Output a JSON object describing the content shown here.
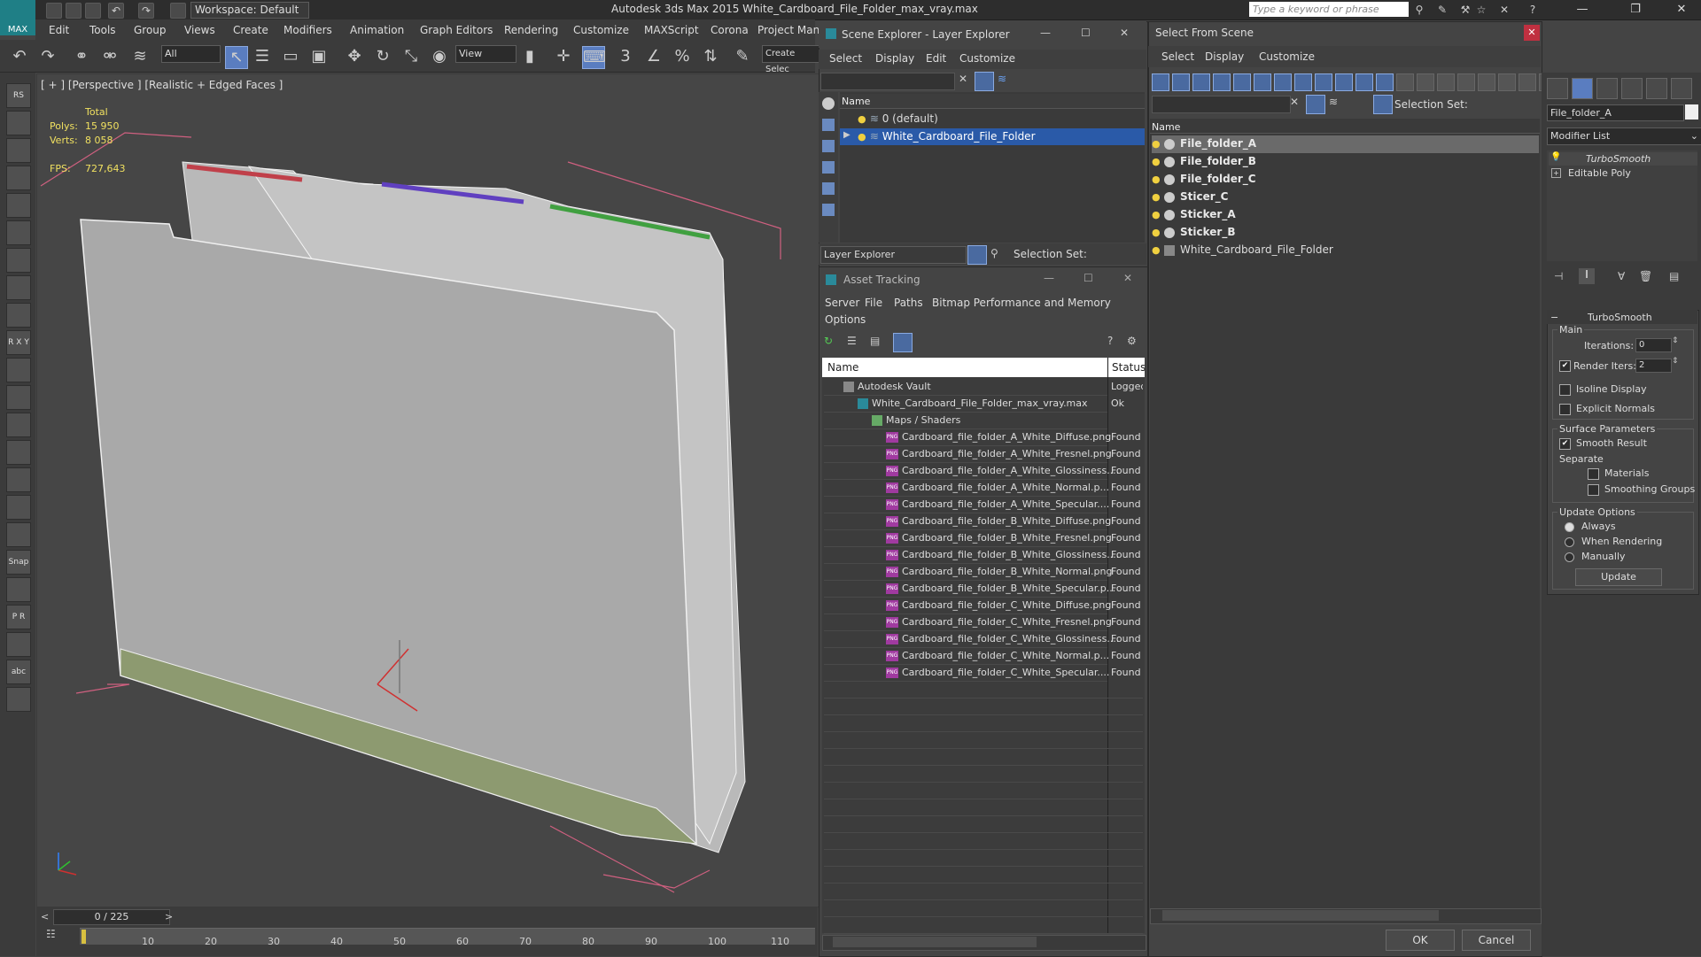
{
  "titlebar": {
    "workspace": "Workspace: Default",
    "app_title": "Autodesk 3ds Max  2015     White_Cardboard_File_Folder_max_vray.max",
    "search_placeholder": "Type a keyword or phrase"
  },
  "menubar": [
    "Edit",
    "Tools",
    "Group",
    "Views",
    "Create",
    "Modifiers",
    "Animation",
    "Graph Editors",
    "Rendering",
    "Customize",
    "MAXScript",
    "Corona",
    "Project Man"
  ],
  "toolbar": {
    "filter_value": "All",
    "coord_value": "View",
    "create_selection": "Create Selec"
  },
  "viewport": {
    "label": "[ + ] [Perspective ] [Realistic + Edged Faces ]",
    "stats_total": "Total",
    "polys_label": "Polys:",
    "polys_value": "15 950",
    "verts_label": "Verts:",
    "verts_value": "8 058",
    "fps_label": "FPS:",
    "fps_value": "727,643"
  },
  "timeline": {
    "frames": "0 / 225",
    "ticks": [
      "10",
      "20",
      "30",
      "40",
      "50",
      "60",
      "70",
      "80",
      "90",
      "100",
      "110"
    ]
  },
  "left_buttons": [
    "RS",
    "",
    "",
    "",
    "",
    "",
    "",
    "",
    "",
    "R X Y Z",
    "",
    "",
    "",
    "",
    "",
    "",
    "",
    "Snap Shot",
    "",
    "P R",
    "",
    "abc",
    ""
  ],
  "scene_explorer": {
    "title": "Scene Explorer - Layer Explorer",
    "menu": [
      "Select",
      "Display",
      "Edit",
      "Customize"
    ],
    "col_name": "Name",
    "rows": [
      "0 (default)",
      "White_Cardboard_File_Folder"
    ],
    "footer_dropdown": "Layer Explorer",
    "selection_set": "Selection Set:"
  },
  "asset_tracking": {
    "title": "Asset Tracking",
    "menu": [
      "Server",
      "File",
      "Paths",
      "Bitmap Performance and Memory"
    ],
    "menu2": "Options",
    "col_name": "Name",
    "col_status": "Status",
    "rows": [
      {
        "name": "Autodesk Vault",
        "status": "Logged",
        "indent": 0,
        "icon": "vault"
      },
      {
        "name": "White_Cardboard_File_Folder_max_vray.max",
        "status": "Ok",
        "indent": 1,
        "icon": "max"
      },
      {
        "name": "Maps / Shaders",
        "status": "",
        "indent": 2,
        "icon": "maps"
      },
      {
        "name": "Cardboard_file_folder_A_White_Diffuse.png",
        "status": "Found",
        "indent": 3,
        "icon": "png"
      },
      {
        "name": "Cardboard_file_folder_A_White_Fresnel.png",
        "status": "Found",
        "indent": 3,
        "icon": "png"
      },
      {
        "name": "Cardboard_file_folder_A_White_Glossiness....",
        "status": "Found",
        "indent": 3,
        "icon": "png"
      },
      {
        "name": "Cardboard_file_folder_A_White_Normal.p...",
        "status": "Found",
        "indent": 3,
        "icon": "png"
      },
      {
        "name": "Cardboard_file_folder_A_White_Specular....",
        "status": "Found",
        "indent": 3,
        "icon": "png"
      },
      {
        "name": "Cardboard_file_folder_B_White_Diffuse.png",
        "status": "Found",
        "indent": 3,
        "icon": "png"
      },
      {
        "name": "Cardboard_file_folder_B_White_Fresnel.png",
        "status": "Found",
        "indent": 3,
        "icon": "png"
      },
      {
        "name": "Cardboard_file_folder_B_White_Glossiness....",
        "status": "Found",
        "indent": 3,
        "icon": "png"
      },
      {
        "name": "Cardboard_file_folder_B_White_Normal.png",
        "status": "Found",
        "indent": 3,
        "icon": "png"
      },
      {
        "name": "Cardboard_file_folder_B_White_Specular.p...",
        "status": "Found",
        "indent": 3,
        "icon": "png"
      },
      {
        "name": "Cardboard_file_folder_C_White_Diffuse.png",
        "status": "Found",
        "indent": 3,
        "icon": "png"
      },
      {
        "name": "Cardboard_file_folder_C_White_Fresnel.png",
        "status": "Found",
        "indent": 3,
        "icon": "png"
      },
      {
        "name": "Cardboard_file_folder_C_White_Glossiness....",
        "status": "Found",
        "indent": 3,
        "icon": "png"
      },
      {
        "name": "Cardboard_file_folder_C_White_Normal.p...",
        "status": "Found",
        "indent": 3,
        "icon": "png"
      },
      {
        "name": "Cardboard_file_folder_C_White_Specular....",
        "status": "Found",
        "indent": 3,
        "icon": "png"
      }
    ]
  },
  "select_from_scene": {
    "title": "Select From Scene",
    "menu": [
      "Select",
      "Display",
      "Customize"
    ],
    "selection_set": "Selection Set:",
    "col_name": "Name",
    "rows": [
      "File_folder_A",
      "File_folder_B",
      "File_folder_C",
      "Sticer_C",
      "Sticker_A",
      "Sticker_B",
      "White_Cardboard_File_Folder"
    ],
    "ok": "OK",
    "cancel": "Cancel"
  },
  "command_panel": {
    "object_name": "File_folder_A",
    "modifier_list": "Modifier List",
    "stack": [
      "TurboSmooth",
      "Editable Poly"
    ],
    "rollout_title": "TurboSmooth",
    "main": "Main",
    "iterations_label": "Iterations:",
    "iterations_value": "0",
    "render_iters_label": "Render Iters:",
    "render_iters_value": "2",
    "isoline": "Isoline Display",
    "explicit_normals": "Explicit Normals",
    "surface_params": "Surface Parameters",
    "smooth_result": "Smooth Result",
    "separate": "Separate",
    "materials": "Materials",
    "smoothing_groups": "Smoothing Groups",
    "update_options": "Update Options",
    "always": "Always",
    "when_rendering": "When Rendering",
    "manually": "Manually",
    "update_btn": "Update"
  }
}
